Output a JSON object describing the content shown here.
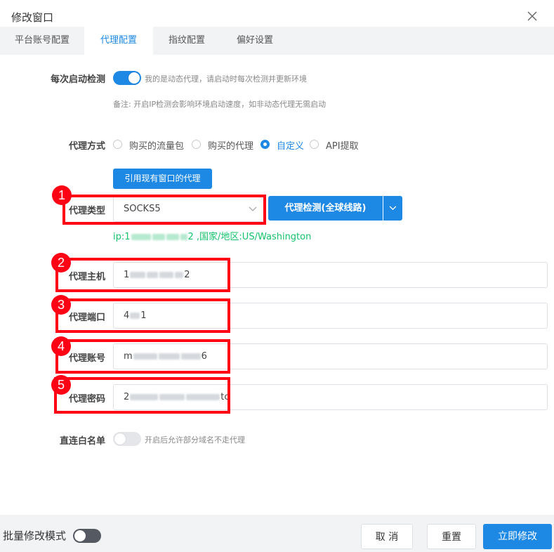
{
  "dialog": {
    "title": "修改窗口"
  },
  "tabs": [
    {
      "label": "平台账号配置"
    },
    {
      "label": "代理配置",
      "active": true
    },
    {
      "label": "指纹配置"
    },
    {
      "label": "偏好设置"
    }
  ],
  "startup_check": {
    "label": "每次启动检测",
    "enabled": true,
    "switch_text": "我的是动态代理，请启动时每次检测并更新环境",
    "note": "备注: 开启IP检测会影响环境启动速度，如非动态代理无需启动"
  },
  "proxy_method": {
    "label": "代理方式",
    "options": [
      "购买的流量包",
      "购买的代理",
      "自定义",
      "API提取"
    ],
    "selected": "自定义"
  },
  "use_existing_button": "引用现有窗口的代理",
  "proxy_type": {
    "label": "代理类型",
    "value": "SOCKS5"
  },
  "check_button": "代理检测(全球线路)",
  "ip_result": {
    "prefix": "ip:1",
    "suffix": "2 ,国家/地区:US/Washington"
  },
  "host": {
    "label": "代理主机",
    "visible_start": "1",
    "visible_end": "2"
  },
  "port": {
    "label": "代理端口",
    "visible_start": "4",
    "visible_end": "1"
  },
  "account": {
    "label": "代理账号",
    "visible_start": "m",
    "visible_end": "6"
  },
  "password": {
    "label": "代理密码",
    "visible_start": "2",
    "visible_end": "tc"
  },
  "whitelist": {
    "label": "直连白名单",
    "enabled": false,
    "switch_text": "开启后允许部分域名不走代理"
  },
  "annotations": [
    "1",
    "2",
    "3",
    "4",
    "5"
  ],
  "footer": {
    "batch_label": "批量修改模式",
    "batch_enabled": false,
    "cancel": "取 消",
    "reset": "重置",
    "submit": "立即修改"
  },
  "colors": {
    "accent": "#1e88e5",
    "annotation": "#ff0015",
    "ip_text": "#13c26b"
  }
}
